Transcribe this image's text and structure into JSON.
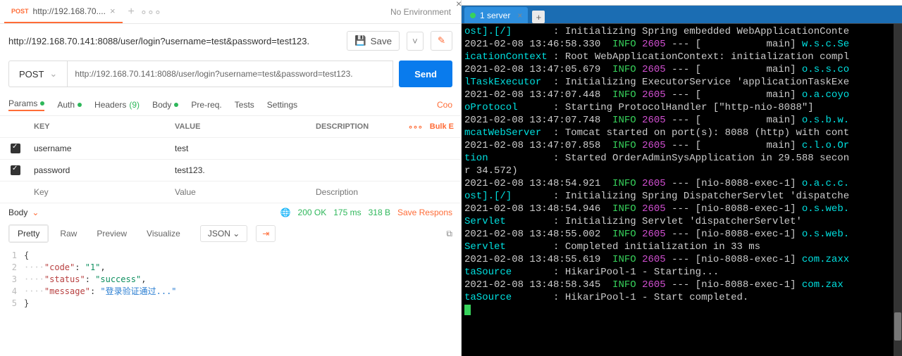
{
  "tab": {
    "method": "POST",
    "label": "http://192.168.70...."
  },
  "env": "No Environment",
  "url_title": "http://192.168.70.141:8088/user/login?username=test&password=test123.",
  "save_label": "Save",
  "method_select": "POST",
  "url": "http://192.168.70.141:8088/user/login?username=test&password=test123.",
  "send_label": "Send",
  "subtabs": {
    "params": "Params",
    "auth": "Auth",
    "headers": "Headers",
    "headers_count": "(9)",
    "body": "Body",
    "prereq": "Pre-req.",
    "tests": "Tests",
    "settings": "Settings"
  },
  "cookies_label": "Coo",
  "params_header": {
    "key": "KEY",
    "value": "VALUE",
    "desc": "DESCRIPTION",
    "bulk": "Bulk E"
  },
  "params": [
    {
      "checked": true,
      "key": "username",
      "value": "test",
      "desc": ""
    },
    {
      "checked": true,
      "key": "password",
      "value": "test123.",
      "desc": ""
    }
  ],
  "params_placeholder": {
    "key": "Key",
    "value": "Value",
    "desc": "Description"
  },
  "body_sel_label": "Body",
  "status": {
    "code": "200 OK",
    "time": "175 ms",
    "size": "318 B"
  },
  "save_response": "Save Respons",
  "resp_tabs": {
    "pretty": "Pretty",
    "raw": "Raw",
    "preview": "Preview",
    "visualize": "Visualize"
  },
  "json_sel": "JSON",
  "code_lines": [
    "{",
    "····\"code\": \"1\",",
    "····\"status\": \"success\",",
    "····\"message\": \"登录验证通过...\"",
    "}"
  ],
  "response_body": {
    "code": "1",
    "status": "success",
    "message": "登录验证通过..."
  },
  "terminal": {
    "tab_label": "1 server",
    "lines_html": [
      "<span class='c-cyan'>ost].[/]</span>       : Initializing Spring embedded WebApplicationConte",
      "2021-02-08 13:46:58.330  <span class='c-green'>INFO</span> <span class='c-mag'>2605</span> --- [           main] <span class='c-cyan'>w.s.c.Se</span>",
      "<span class='c-cyan'>icationContext</span> : Root WebApplicationContext: initialization compl",
      "2021-02-08 13:47:05.679  <span class='c-green'>INFO</span> <span class='c-mag'>2605</span> --- [           main] <span class='c-cyan'>o.s.s.co</span>",
      "<span class='c-cyan'>lTaskExecutor</span>  : Initializing ExecutorService 'applicationTaskExe",
      "2021-02-08 13:47:07.448  <span class='c-green'>INFO</span> <span class='c-mag'>2605</span> --- [           main] <span class='c-cyan'>o.a.coyo</span>",
      "<span class='c-cyan'>oProtocol</span>      : Starting ProtocolHandler [\"http-nio-8088\"]",
      "2021-02-08 13:47:07.748  <span class='c-green'>INFO</span> <span class='c-mag'>2605</span> --- [           main] <span class='c-cyan'>o.s.b.w.</span>",
      "<span class='c-cyan'>mcatWebServer</span>  : Tomcat started on port(s): 8088 (http) with cont",
      "2021-02-08 13:47:07.858  <span class='c-green'>INFO</span> <span class='c-mag'>2605</span> --- [           main] <span class='c-cyan'>c.l.o.Or</span>",
      "<span class='c-cyan'>tion</span>           : Started OrderAdminSysApplication in 29.588 secon",
      "r 34.572)",
      "2021-02-08 13:48:54.921  <span class='c-green'>INFO</span> <span class='c-mag'>2605</span> --- [nio-8088-exec-1] <span class='c-cyan'>o.a.c.c.</span>",
      "<span class='c-cyan'>ost].[/]</span>       : Initializing Spring DispatcherServlet 'dispatche",
      "2021-02-08 13:48:54.946  <span class='c-green'>INFO</span> <span class='c-mag'>2605</span> --- [nio-8088-exec-1] <span class='c-cyan'>o.s.web.</span>",
      "<span class='c-cyan'>Servlet</span>        : Initializing Servlet 'dispatcherServlet'",
      "2021-02-08 13:48:55.002  <span class='c-green'>INFO</span> <span class='c-mag'>2605</span> --- [nio-8088-exec-1] <span class='c-cyan'>o.s.web.</span>",
      "<span class='c-cyan'>Servlet</span>        : Completed initialization in 33 ms",
      "2021-02-08 13:48:55.619  <span class='c-green'>INFO</span> <span class='c-mag'>2605</span> --- [nio-8088-exec-1] <span class='c-cyan'>com.zaxx</span>",
      "<span class='c-cyan'>taSource</span>       : HikariPool-1 - Starting...",
      "2021-02-08 13:48:58.345  <span class='c-green'>INFO</span> <span class='c-mag'>2605</span> --- [nio-8088-exec-1] <span class='c-cyan'>com.zax</span>",
      "<span class='c-cyan'>taSource</span>       : HikariPool-1 - Start completed."
    ]
  }
}
